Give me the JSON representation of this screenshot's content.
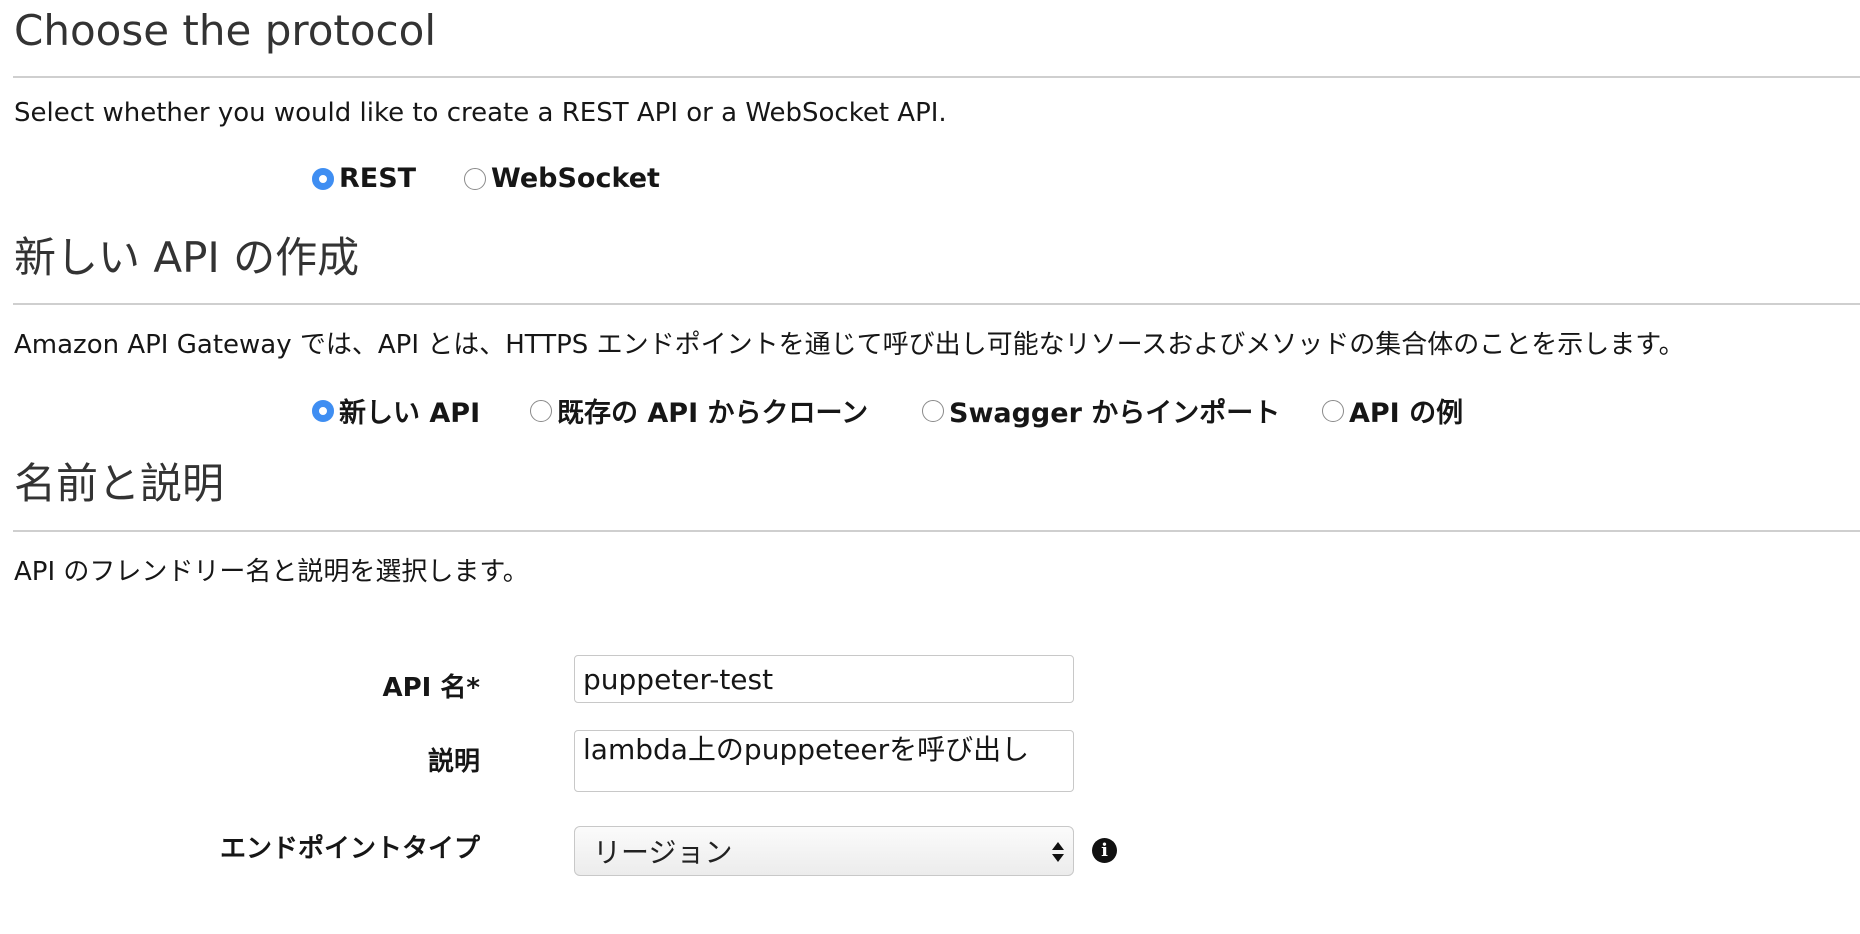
{
  "protocol": {
    "title": "Choose the protocol",
    "description": "Select whether you would like to create a REST API or a WebSocket API.",
    "options": [
      {
        "label": "REST",
        "selected": true
      },
      {
        "label": "WebSocket",
        "selected": false
      }
    ]
  },
  "create_api": {
    "title": "新しい API の作成",
    "description": "Amazon API Gateway では、API とは、HTTPS エンドポイントを通じて呼び出し可能なリソースおよびメソッドの集合体のことを示します。",
    "options": [
      {
        "label": "新しい API",
        "selected": true
      },
      {
        "label": "既存の API からクローン",
        "selected": false
      },
      {
        "label": "Swagger からインポート",
        "selected": false
      },
      {
        "label": "API の例",
        "selected": false
      }
    ]
  },
  "name_desc": {
    "title": "名前と説明",
    "description": "API のフレンドリー名と説明を選択します。"
  },
  "form": {
    "api_name_label": "API 名*",
    "api_name_value": "puppeter-test",
    "description_label": "説明",
    "description_value": "lambda上のpuppeteerを呼び出し",
    "endpoint_type_label": "エンドポイントタイプ",
    "endpoint_type_value": "リージョン",
    "info_icon": "info-icon"
  },
  "colors": {
    "radio_selected": "#3f8ef2",
    "divider": "#cfcfcf"
  }
}
